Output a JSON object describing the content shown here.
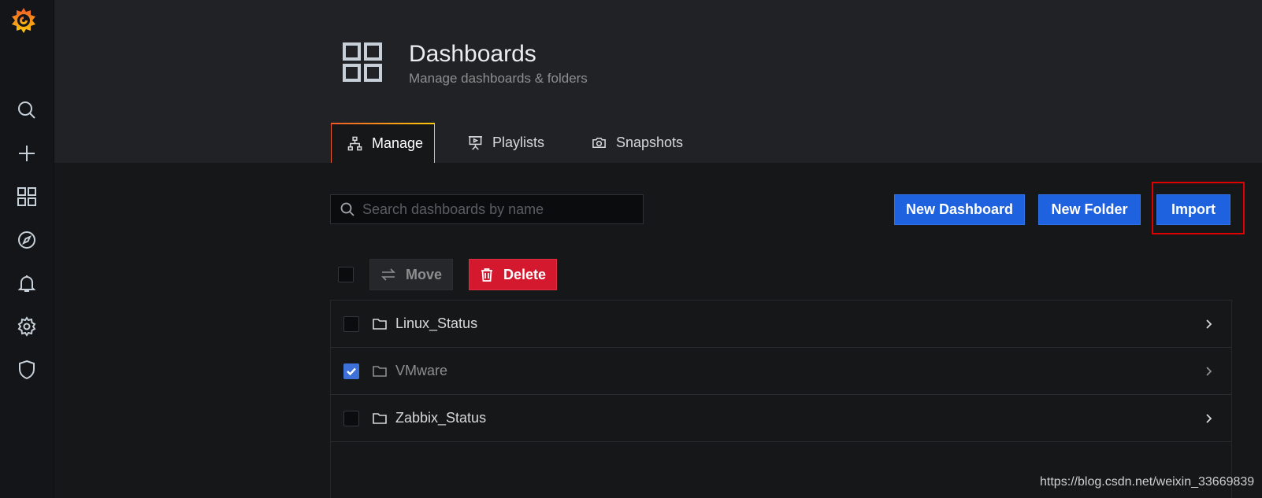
{
  "sidebar": {
    "logo": "grafana-logo-icon",
    "items": [
      {
        "icon": "search-icon"
      },
      {
        "icon": "plus-icon"
      },
      {
        "icon": "dashboards-icon"
      },
      {
        "icon": "compass-icon"
      },
      {
        "icon": "bell-icon"
      },
      {
        "icon": "gear-icon"
      },
      {
        "icon": "shield-icon"
      }
    ]
  },
  "header": {
    "title": "Dashboards",
    "subtitle": "Manage dashboards & folders",
    "tabs": [
      {
        "label": "Manage",
        "icon": "sitemap-icon",
        "active": true
      },
      {
        "label": "Playlists",
        "icon": "presentation-icon",
        "active": false
      },
      {
        "label": "Snapshots",
        "icon": "camera-icon",
        "active": false
      }
    ]
  },
  "toolbar": {
    "search_placeholder": "Search dashboards by name",
    "new_dashboard_label": "New Dashboard",
    "new_folder_label": "New Folder",
    "import_label": "Import"
  },
  "actions": {
    "move_label": "Move",
    "delete_label": "Delete"
  },
  "folders": [
    {
      "name": "Linux_Status",
      "checked": false
    },
    {
      "name": "VMware",
      "checked": true
    },
    {
      "name": "Zabbix_Status",
      "checked": false
    }
  ],
  "watermark": "https://blog.csdn.net/weixin_33669839",
  "colors": {
    "primary_button": "#1f62e0",
    "danger_button": "#d4192f",
    "tab_accent": "#f79520",
    "highlight_box": "#e00000"
  }
}
